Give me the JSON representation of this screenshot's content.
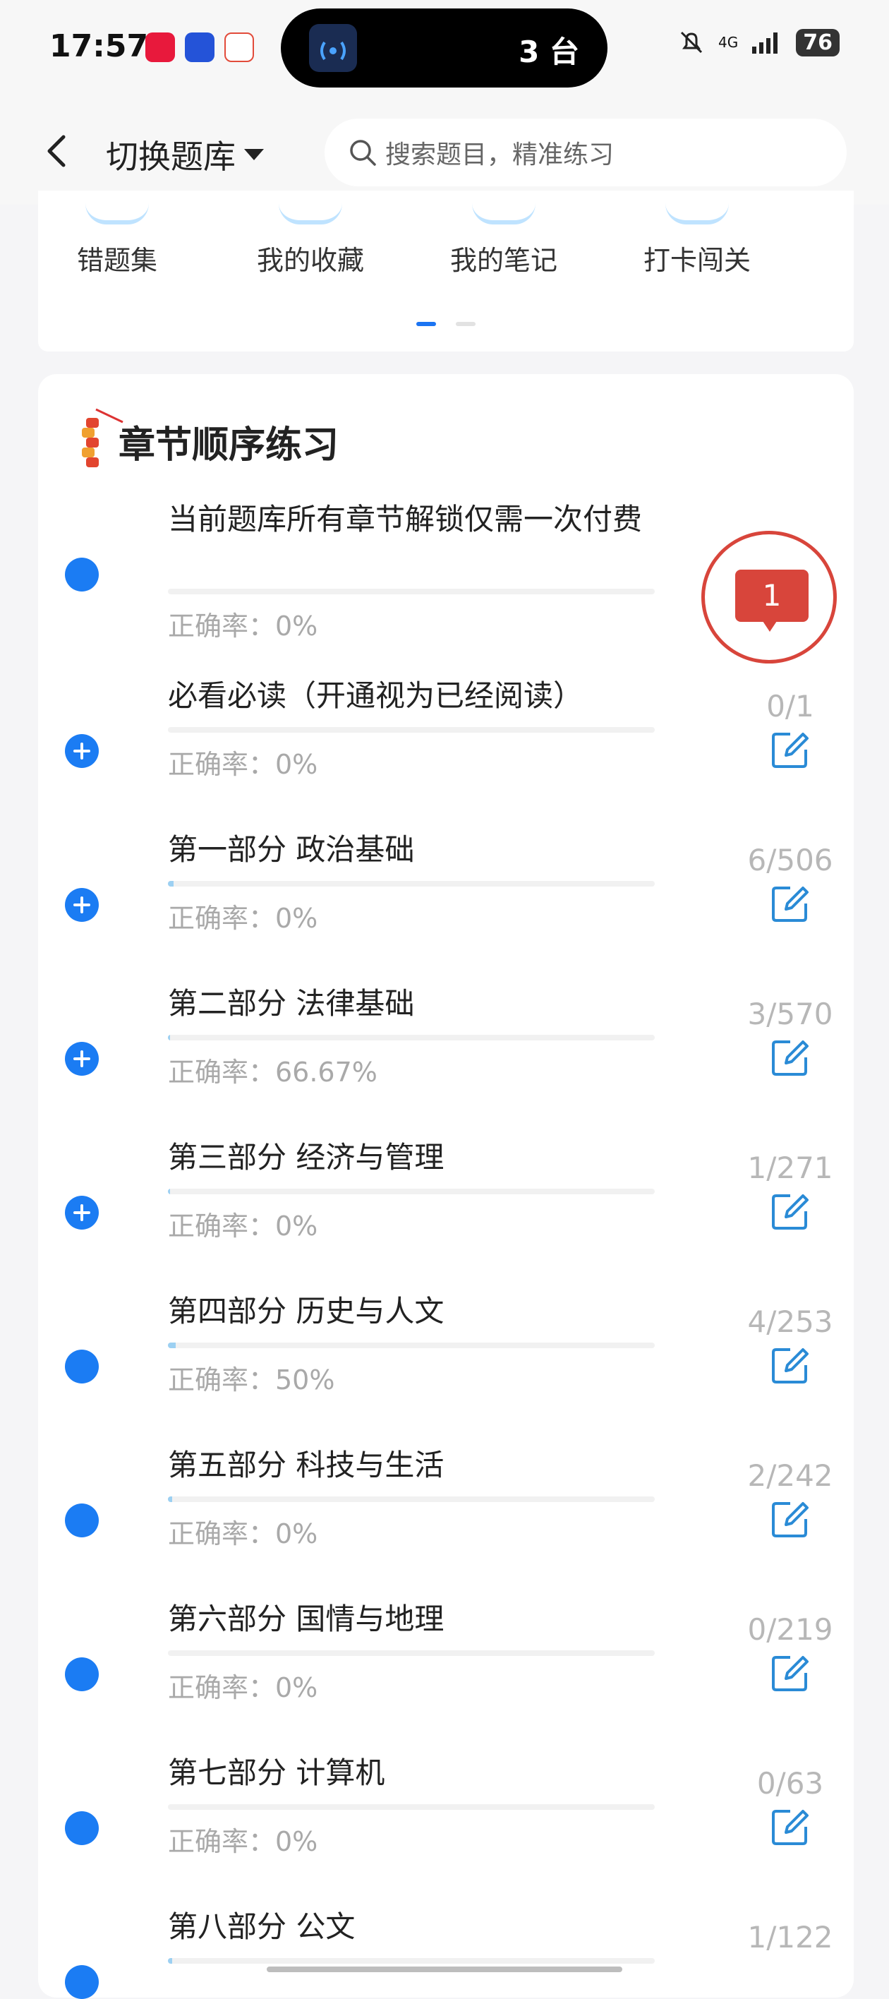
{
  "status_bar": {
    "time": "17:57",
    "apps": [
      {
        "name": "xiaohongshu",
        "color": "#e8193c"
      },
      {
        "name": "security-app",
        "color": "#2453d8"
      },
      {
        "name": "triangle-app",
        "color": "#e24b3a"
      }
    ],
    "island_text": "3 台",
    "network": "4G",
    "battery": "76"
  },
  "header": {
    "bank_switch_label": "切换题库",
    "search_placeholder": "搜索题目，精准练习"
  },
  "tools": [
    "错题集",
    "我的收藏",
    "我的笔记",
    "打卡闯关"
  ],
  "section_title": "章节顺序练习",
  "chapters": [
    {
      "title": "当前题库所有章节解锁仅需一次付费",
      "accuracy": "正确率：0%",
      "count": "",
      "progress": 0,
      "expandable": false
    },
    {
      "title": "必看必读（开通视为已经阅读）",
      "accuracy": "正确率：0%",
      "count": "0/1",
      "progress": 0,
      "expandable": true
    },
    {
      "title": "第一部分 政治基础",
      "accuracy": "正确率：0%",
      "count": "6/506",
      "progress": 0.012,
      "expandable": true
    },
    {
      "title": "第二部分 法律基础",
      "accuracy": "正确率：66.67%",
      "count": "3/570",
      "progress": 0.005,
      "expandable": true
    },
    {
      "title": "第三部分 经济与管理",
      "accuracy": "正确率：0%",
      "count": "1/271",
      "progress": 0.004,
      "expandable": true
    },
    {
      "title": "第四部分 历史与人文",
      "accuracy": "正确率：50%",
      "count": "4/253",
      "progress": 0.016,
      "expandable": false
    },
    {
      "title": "第五部分 科技与生活",
      "accuracy": "正确率：0%",
      "count": "2/242",
      "progress": 0.008,
      "expandable": false
    },
    {
      "title": "第六部分 国情与地理",
      "accuracy": "正确率：0%",
      "count": "0/219",
      "progress": 0,
      "expandable": false
    },
    {
      "title": "第七部分 计算机",
      "accuracy": "正确率：0%",
      "count": "0/63",
      "progress": 0,
      "expandable": false
    },
    {
      "title": "第八部分 公文",
      "accuracy": "",
      "count": "1/122",
      "progress": 0.008,
      "expandable": false
    }
  ],
  "message_badge": "1",
  "colors": {
    "accent": "#1b7cf3",
    "badge_red": "#d8453b",
    "edit_blue": "#2a8bd6"
  }
}
